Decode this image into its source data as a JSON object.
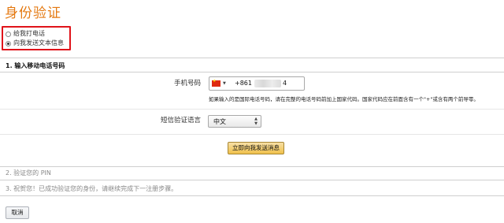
{
  "page": {
    "title": "身份验证"
  },
  "options": [
    {
      "label": "给我打电话",
      "checked": false
    },
    {
      "label": "向我发送文本信息",
      "checked": true
    }
  ],
  "steps": {
    "step1": "1. 输入移动电话号码",
    "step2": "2. 验证您的 PIN",
    "step3": "3. 祝贺您！已成功验证您的身份，请继续完成下一注册步骤。"
  },
  "phone": {
    "label": "手机号码",
    "country_flag": "china-flag-icon",
    "value": "+861",
    "value_suffix": "4",
    "hint": "如果输入的是国际电话号码，请在完整的电话号码前加上国家代码。国家代码应在前面含有一个\"+\"或含有两个前导零。"
  },
  "language": {
    "label": "短信验证语言",
    "selected": "中文"
  },
  "buttons": {
    "send": "立即向我发送消息",
    "cancel": "取消"
  },
  "colors": {
    "title": "#e47911",
    "highlight_border": "#e0131a",
    "send_button": "#f0c14b"
  }
}
